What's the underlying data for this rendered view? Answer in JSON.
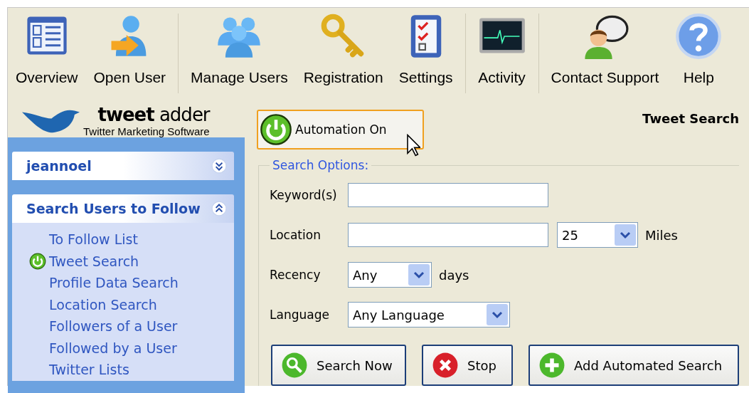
{
  "toolbar": {
    "groups": [
      [
        {
          "label": "Overview"
        },
        {
          "label": "Open User"
        }
      ],
      [
        {
          "label": "Manage Users"
        },
        {
          "label": "Registration"
        },
        {
          "label": "Settings"
        }
      ],
      [
        {
          "label": "Activity"
        }
      ],
      [
        {
          "label": "Contact Support"
        },
        {
          "label": "Help"
        }
      ]
    ]
  },
  "logo": {
    "name_bold": "tweet",
    "name_light": "adder",
    "tagline": "Twitter Marketing Software"
  },
  "sidebar": {
    "panels": [
      {
        "title": "jeannoel",
        "expanded": false
      },
      {
        "title": "Search Users to Follow",
        "expanded": true,
        "items": [
          {
            "label": "To Follow List",
            "automation_on": false
          },
          {
            "label": "Tweet Search",
            "automation_on": true
          },
          {
            "label": "Profile Data Search",
            "automation_on": false
          },
          {
            "label": "Location Search",
            "automation_on": false
          },
          {
            "label": "Followers of a User",
            "automation_on": false
          },
          {
            "label": "Followed by a User",
            "automation_on": false
          },
          {
            "label": "Twitter Lists",
            "automation_on": false
          }
        ]
      }
    ]
  },
  "automation_button": {
    "label": "Automation On"
  },
  "page_title": "Tweet Search",
  "search_options": {
    "legend": "Search Options:",
    "rows": [
      {
        "label": "Keyword(s)",
        "kind": "text",
        "value": ""
      },
      {
        "label": "Location",
        "kind": "text",
        "value": "",
        "select": {
          "value": "25"
        },
        "unit": "Miles"
      },
      {
        "label": "Recency",
        "kind": "select",
        "select": {
          "value": "Any"
        },
        "unit": "days"
      },
      {
        "label": "Language",
        "kind": "select",
        "select": {
          "value": "Any Language"
        }
      }
    ],
    "buttons": [
      {
        "label": "Search Now",
        "kind": "search"
      },
      {
        "label": "Stop",
        "kind": "stop"
      },
      {
        "label": "Add Automated Search",
        "kind": "add"
      }
    ]
  }
}
